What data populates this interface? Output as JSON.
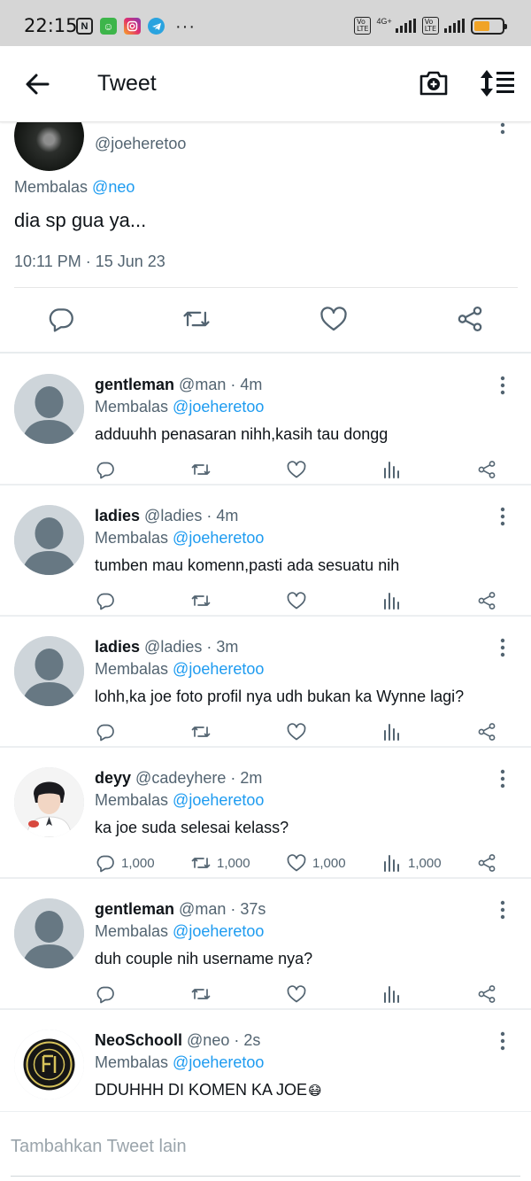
{
  "status_bar": {
    "time": "22:15",
    "battery_color": "#f0a326",
    "network": "4G+"
  },
  "header": {
    "title": "Tweet",
    "back_icon": "arrow-left-icon",
    "camera_icon": "camera-plus-icon",
    "sort_icon": "sort-icon"
  },
  "main_tweet": {
    "handle": "@joeheretoo",
    "reply_prefix": "Membalas",
    "reply_to": "@neo",
    "text": "dia sp gua ya...",
    "timestamp": "10:11 PM · 15 Jun 23"
  },
  "replies": [
    {
      "name": "gentleman",
      "handle": "@man",
      "time": "· 4m",
      "reply_prefix": "Membalas",
      "reply_to": "@joeheretoo",
      "text": "adduuhh penasaran nihh,kasih tau dongg",
      "avatar": "default-avatar",
      "counts": {
        "reply": "",
        "retweet": "",
        "like": "",
        "views": ""
      }
    },
    {
      "name": "ladies",
      "handle": "@ladies",
      "time": "· 4m",
      "reply_prefix": "Membalas",
      "reply_to": "@joeheretoo",
      "text": "tumben mau komenn,pasti ada sesuatu nih",
      "avatar": "default-avatar",
      "counts": {
        "reply": "",
        "retweet": "",
        "like": "",
        "views": ""
      }
    },
    {
      "name": "ladies",
      "handle": "@ladies",
      "time": "· 3m",
      "reply_prefix": "Membalas",
      "reply_to": "@joeheretoo",
      "text": "lohh,ka joe foto profil nya udh bukan ka Wynne lagi?",
      "avatar": "default-avatar",
      "counts": {
        "reply": "",
        "retweet": "",
        "like": "",
        "views": ""
      }
    },
    {
      "name": "deyy",
      "handle": "@cadeyhere",
      "time": "· 2m",
      "reply_prefix": "Membalas",
      "reply_to": "@joeheretoo",
      "text": "ka joe suda selesai kelass?",
      "avatar": "photo-avatar",
      "counts": {
        "reply": "1,000",
        "retweet": "1,000",
        "like": "1,000",
        "views": "1,000"
      }
    },
    {
      "name": "gentleman",
      "handle": "@man",
      "time": "· 37s",
      "reply_prefix": "Membalas",
      "reply_to": "@joeheretoo",
      "text": "duh couple nih username nya?",
      "avatar": "default-avatar",
      "counts": {
        "reply": "",
        "retweet": "",
        "like": "",
        "views": ""
      }
    },
    {
      "name": "NeoSchooll",
      "handle": "@neo",
      "time": "· 2s",
      "reply_prefix": "Membalas",
      "reply_to": "@joeheretoo",
      "text": "DDUHHH DI KOMEN KA JOE",
      "emoji": "😷",
      "avatar": "school-logo-avatar",
      "counts": {
        "reply": "",
        "retweet": "",
        "like": "",
        "views": ""
      }
    }
  ],
  "compose": {
    "placeholder": "Tambahkan Tweet lain"
  },
  "colors": {
    "link": "#1d9bf0",
    "secondary_text": "#536471",
    "primary_text": "#0f1419"
  }
}
